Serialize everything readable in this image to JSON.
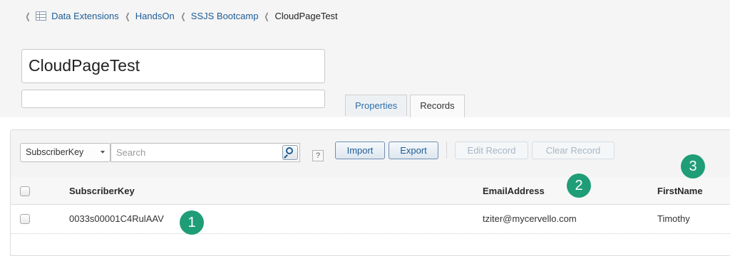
{
  "breadcrumb": {
    "items": [
      {
        "label": "Data Extensions"
      },
      {
        "label": "HandsOn"
      },
      {
        "label": "SSJS Bootcamp"
      },
      {
        "label": "CloudPageTest"
      }
    ]
  },
  "header": {
    "name_value": "CloudPageTest",
    "description_value": ""
  },
  "tabs": [
    {
      "label": "Properties",
      "active": false
    },
    {
      "label": "Records",
      "active": true
    }
  ],
  "toolbar": {
    "field_select": "SubscriberKey",
    "search_placeholder": "Search",
    "help_label": "?",
    "import_label": "Import",
    "export_label": "Export",
    "edit_record_label": "Edit Record",
    "clear_record_label": "Clear Record"
  },
  "table": {
    "columns": [
      {
        "label": "SubscriberKey"
      },
      {
        "label": "EmailAddress"
      },
      {
        "label": "FirstName"
      }
    ],
    "rows": [
      {
        "subscriber_key": "0033s00001C4RulAAV",
        "email": "tziter@mycervello.com",
        "first_name": "Timothy"
      }
    ]
  },
  "markers": [
    "1",
    "2",
    "3"
  ],
  "colors": {
    "link": "#1e5c96",
    "marker": "#1f9d77"
  }
}
